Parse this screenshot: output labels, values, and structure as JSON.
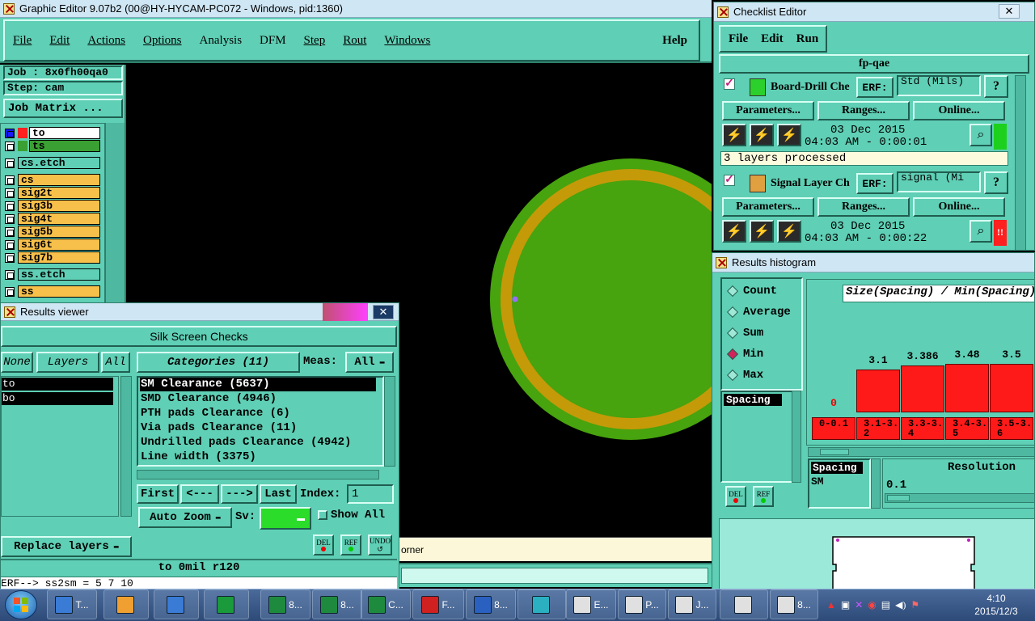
{
  "main_window": {
    "title": "Graphic Editor 9.07b2 (00@HY-HYCAM-PC072 - Windows, pid:1360)",
    "menu": [
      "File",
      "Edit",
      "Actions",
      "Options",
      "Analysis",
      "DFM",
      "Step",
      "Rout",
      "Windows"
    ],
    "help": "Help",
    "job": "Job : 8x0fh00qa0",
    "step": "Step: cam",
    "job_matrix": "Job Matrix ...",
    "layers": [
      {
        "name": "to",
        "color": "#ffffff"
      },
      {
        "name": "ts",
        "color": "#3aa033"
      },
      {
        "name": "cs.etch",
        "color": "#5fcfb5"
      },
      {
        "name": "cs",
        "color": "#f7c04a"
      },
      {
        "name": "sig2t",
        "color": "#f7c04a"
      },
      {
        "name": "sig3b",
        "color": "#f7c04a"
      },
      {
        "name": "sig4t",
        "color": "#f7c04a"
      },
      {
        "name": "sig5b",
        "color": "#f7c04a"
      },
      {
        "name": "sig6t",
        "color": "#f7c04a"
      },
      {
        "name": "sig7b",
        "color": "#f7c04a"
      },
      {
        "name": "ss.etch",
        "color": "#5fcfb5"
      },
      {
        "name": "ss",
        "color": "#f7c04a"
      }
    ],
    "status_strip": "orner"
  },
  "results_viewer": {
    "title": "Results viewer",
    "heading": "Silk Screen Checks",
    "none": "None",
    "layers_label": "Layers",
    "all": "All",
    "layer_list": [
      "to",
      "bo"
    ],
    "categories_label": "Categories (11)",
    "meas_label": "Meas:",
    "meas_value": "All",
    "categories": [
      "SM Clearance (5637)",
      "SMD Clearance (4946)",
      "PTH pads Clearance (6)",
      "Via pads Clearance (11)",
      "Undrilled pads Clearance (4942)",
      "Line width (3375)"
    ],
    "first": "First",
    "prev": "<---",
    "next": "--->",
    "last": "Last",
    "index_label": "Index:",
    "index_value": "1",
    "auto_zoom": "Auto Zoom",
    "sv_label": "Sv:",
    "show_all": "Show All",
    "replace_layers": "Replace layers",
    "del": "DEL",
    "ref": "REF",
    "undo": "UNDO",
    "status_line": "to 0mil  r120",
    "erf_line": "ERF--> ss2sm = 5 7 10"
  },
  "checklist_editor": {
    "title": "Checklist Editor",
    "menu": [
      "File",
      "Edit",
      "Run"
    ],
    "checklist_name": "fp-qae",
    "actions": [
      {
        "name": "Board-Drill Che",
        "erf_label": "ERF:",
        "erf_value": "Std (Mils)",
        "params": "Parameters...",
        "ranges": "Ranges...",
        "online": "Online...",
        "date": "03 Dec 2015",
        "time": "04:03 AM - 0:00:01",
        "status_color": "#1ed01e",
        "message": "3 layers processed"
      },
      {
        "name": "Signal Layer Ch",
        "erf_label": "ERF:",
        "erf_value": "signal (Mi",
        "params": "Parameters...",
        "ranges": "Ranges...",
        "online": "Online...",
        "date": "03 Dec 2015",
        "time": "04:03 AM - 0:00:22",
        "status_color": "#ff2020",
        "status_text": "!!"
      }
    ]
  },
  "histogram": {
    "title": "Results histogram",
    "modes": [
      "Count",
      "Average",
      "Sum",
      "Min",
      "Max"
    ],
    "selected_mode": "Min",
    "list_item": "Spacing",
    "chart_title": "Size(Spacing) / Min(Spacing)",
    "del": "DEL",
    "ref": "REF",
    "lower_list": [
      "Spacing",
      "SM"
    ],
    "resolution_label": "Resolution",
    "resolution_value": "0.1",
    "chart_data": {
      "type": "bar",
      "title": "Size(Spacing) / Min(Spacing)",
      "categories": [
        "0-0.1",
        "3.1-3.2",
        "3.3-3.4",
        "3.4-3.5",
        "3.5-3.6"
      ],
      "values": [
        0,
        3.1,
        3.386,
        3.48,
        3.5
      ],
      "value_labels": [
        "0",
        "3.1",
        "3.386",
        "3.48",
        "3.5"
      ],
      "ylim": [
        0,
        3.5
      ]
    }
  },
  "taskbar": {
    "time": "4:10",
    "date": "2015/12/3",
    "items": [
      "T...",
      "8...",
      "8...",
      "C...",
      "F...",
      "8...",
      "E...",
      "P...",
      "J...",
      "8..."
    ]
  }
}
